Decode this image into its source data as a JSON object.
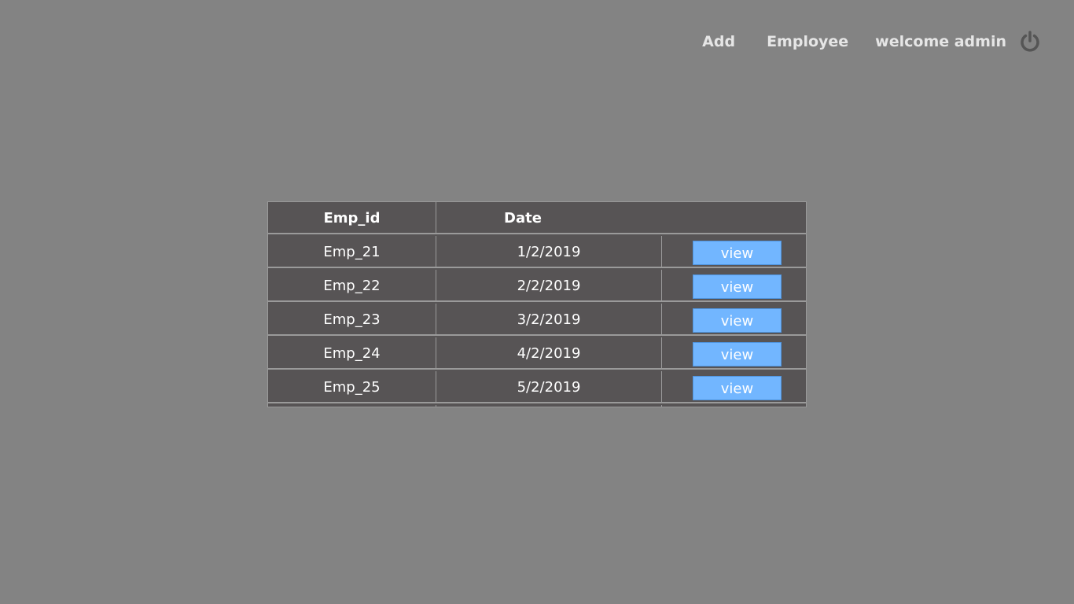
{
  "nav": {
    "add_label": "Add",
    "employee_label": "Employee",
    "welcome_text": "welcome admin",
    "power_icon": "power-icon"
  },
  "table": {
    "headers": [
      "Emp_id",
      "Date",
      ""
    ],
    "rows": [
      {
        "emp_id": "Emp_21",
        "date": "1/2/2019",
        "action": "view"
      },
      {
        "emp_id": "Emp_22",
        "date": "2/2/2019",
        "action": "view"
      },
      {
        "emp_id": "Emp_23",
        "date": "3/2/2019",
        "action": "view"
      },
      {
        "emp_id": "Emp_24",
        "date": "4/2/2019",
        "action": "view"
      },
      {
        "emp_id": "Emp_25",
        "date": "5/2/2019",
        "action": "view"
      }
    ]
  },
  "colors": {
    "background": "#838383",
    "table_bg": "#575455",
    "button_bg": "#72b6ff"
  }
}
